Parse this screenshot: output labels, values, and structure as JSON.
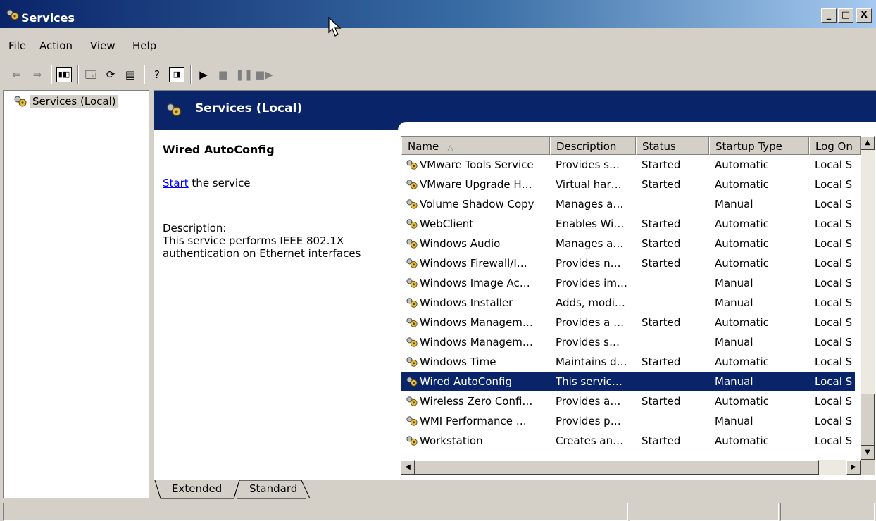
{
  "window": {
    "title": "Services",
    "min": "_",
    "max": "□",
    "close": "X"
  },
  "menu": [
    "File",
    "Action",
    "View",
    "Help"
  ],
  "tree": {
    "root": "Services (Local)"
  },
  "header": {
    "title": "Services (Local)"
  },
  "details": {
    "service_name": "Wired AutoConfig",
    "start_link": "Start",
    "start_suffix": " the service",
    "description_label": "Description:",
    "description_text": "This service performs IEEE 802.1X authentication on Ethernet interfaces"
  },
  "columns": [
    "Name",
    "Description",
    "Status",
    "Startup Type",
    "Log On"
  ],
  "rows": [
    {
      "name": "VMware Tools Service",
      "desc": "Provides s…",
      "status": "Started",
      "startup": "Automatic",
      "logon": "Local S"
    },
    {
      "name": "VMware Upgrade H…",
      "desc": "Virtual har…",
      "status": "Started",
      "startup": "Automatic",
      "logon": "Local S"
    },
    {
      "name": "Volume Shadow Copy",
      "desc": "Manages a…",
      "status": "",
      "startup": "Manual",
      "logon": "Local S"
    },
    {
      "name": "WebClient",
      "desc": "Enables Wi…",
      "status": "Started",
      "startup": "Automatic",
      "logon": "Local S"
    },
    {
      "name": "Windows Audio",
      "desc": "Manages a…",
      "status": "Started",
      "startup": "Automatic",
      "logon": "Local S"
    },
    {
      "name": "Windows Firewall/I…",
      "desc": "Provides n…",
      "status": "Started",
      "startup": "Automatic",
      "logon": "Local S"
    },
    {
      "name": "Windows Image Ac…",
      "desc": "Provides im…",
      "status": "",
      "startup": "Manual",
      "logon": "Local S"
    },
    {
      "name": "Windows Installer",
      "desc": "Adds, modi…",
      "status": "",
      "startup": "Manual",
      "logon": "Local S"
    },
    {
      "name": "Windows Managem…",
      "desc": "Provides a …",
      "status": "Started",
      "startup": "Automatic",
      "logon": "Local S"
    },
    {
      "name": "Windows Managem…",
      "desc": "Provides s…",
      "status": "",
      "startup": "Manual",
      "logon": "Local S"
    },
    {
      "name": "Windows Time",
      "desc": "Maintains d…",
      "status": "Started",
      "startup": "Automatic",
      "logon": "Local S"
    },
    {
      "name": "Wired AutoConfig",
      "desc": "This servic…",
      "status": "",
      "startup": "Manual",
      "logon": "Local S",
      "selected": true
    },
    {
      "name": "Wireless Zero Confi…",
      "desc": "Provides a…",
      "status": "Started",
      "startup": "Automatic",
      "logon": "Local S"
    },
    {
      "name": "WMI Performance …",
      "desc": "Provides p…",
      "status": "",
      "startup": "Manual",
      "logon": "Local S"
    },
    {
      "name": "Workstation",
      "desc": "Creates an…",
      "status": "Started",
      "startup": "Automatic",
      "logon": "Local S"
    }
  ],
  "tabs": [
    "Extended",
    "Standard"
  ],
  "icons": {
    "app": "services-gears-icon",
    "toolbar": [
      "back-arrow-icon",
      "forward-arrow-icon",
      "show-hide-tree-icon",
      "properties-icon",
      "refresh-icon",
      "export-list-icon",
      "help-icon",
      "action-pane-icon",
      "play-icon",
      "stop-icon",
      "pause-icon",
      "restart-icon"
    ]
  },
  "colors": {
    "title_start": "#0a246a",
    "title_end": "#a6caf0",
    "selection": "#0a246a",
    "link": "#0000ff",
    "face": "#d4d0c8"
  }
}
